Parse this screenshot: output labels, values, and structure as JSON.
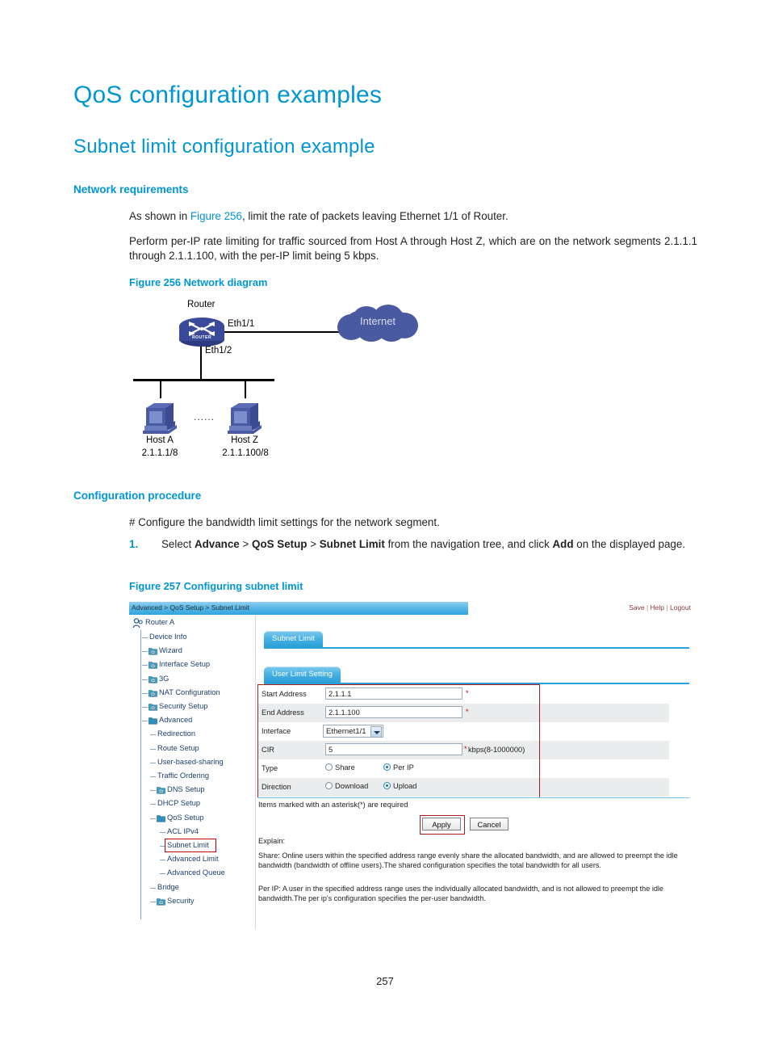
{
  "document": {
    "title": "QoS configuration examples",
    "subtitle": "Subnet limit configuration example",
    "section_network": "Network requirements",
    "section_procedure": "Configuration procedure",
    "para1_a": "As shown in ",
    "para1_link": "Figure 256",
    "para1_b": ", limit the rate of packets leaving Ethernet 1/1 of Router.",
    "para2": "Perform per-IP rate limiting for traffic sourced from Host A through Host Z, which are on the network segments 2.1.1.1 through 2.1.1.100, with the per-IP limit being 5 kbps.",
    "figcap256": "Figure 256 Network diagram",
    "para3": "# Configure the bandwidth limit settings for the network segment.",
    "step1_num": "1.",
    "step1_a": "Select ",
    "step1_b1": "Advance",
    "step1_c": " > ",
    "step1_b2": "QoS Setup",
    "step1_d": " > ",
    "step1_b3": "Subnet Limit",
    "step1_e": " from the navigation tree, and click ",
    "step1_b4": "Add",
    "step1_f": " on the displayed page.",
    "figcap257": "Figure 257 Configuring subnet limit",
    "page_number": "257",
    "accent_color": "#0096d6"
  },
  "diagram": {
    "router_label": "Router",
    "router_badge": "ROUTER",
    "eth1_1": "Eth1/1",
    "eth1_2": "Eth1/2",
    "internet": "Internet",
    "host_a": "Host A",
    "host_a_ip": "2.1.1.1/8",
    "host_z": "Host Z",
    "host_z_ip": "2.1.1.100/8",
    "ellipsis": "......",
    "node_color": "#4a5aa0"
  },
  "webui": {
    "breadcrumb": "Advanced > QoS Setup > Subnet Limit",
    "account": {
      "save": "Save",
      "help": "Help",
      "logout": "Logout",
      "sep": "|"
    },
    "tree": {
      "root": "Router A",
      "items": [
        {
          "label": "Device Info",
          "icon": "none",
          "indent": 1
        },
        {
          "label": "Wizard",
          "icon": "folder-plus-icon",
          "indent": 1
        },
        {
          "label": "Interface Setup",
          "icon": "folder-plus-icon",
          "indent": 1
        },
        {
          "label": "3G",
          "icon": "folder-plus-icon",
          "indent": 1
        },
        {
          "label": "NAT Configuration",
          "icon": "folder-plus-icon",
          "indent": 1
        },
        {
          "label": "Security Setup",
          "icon": "folder-plus-icon",
          "indent": 1
        },
        {
          "label": "Advanced",
          "icon": "folder-open-icon",
          "indent": 1
        },
        {
          "label": "Redirection",
          "icon": "none",
          "indent": 2
        },
        {
          "label": "Route Setup",
          "icon": "none",
          "indent": 2
        },
        {
          "label": "User-based-sharing",
          "icon": "none",
          "indent": 2
        },
        {
          "label": "Traffic Ordering",
          "icon": "none",
          "indent": 2
        },
        {
          "label": "DNS Setup",
          "icon": "folder-plus-icon",
          "indent": 2
        },
        {
          "label": "DHCP Setup",
          "icon": "none",
          "indent": 2
        },
        {
          "label": "QoS Setup",
          "icon": "folder-open-icon",
          "indent": 2
        },
        {
          "label": "ACL IPv4",
          "icon": "none",
          "indent": 3
        },
        {
          "label": "Subnet Limit",
          "icon": "none",
          "indent": 3,
          "selected": true
        },
        {
          "label": "Advanced Limit",
          "icon": "none",
          "indent": 3
        },
        {
          "label": "Advanced Queue",
          "icon": "none",
          "indent": 3
        },
        {
          "label": "Bridge",
          "icon": "none",
          "indent": 2
        },
        {
          "label": "Security",
          "icon": "folder-plus-icon",
          "indent": 2
        }
      ]
    },
    "tabs": {
      "primary": "Subnet Limit",
      "secondary": "User Limit Setting"
    },
    "form": {
      "rows": [
        {
          "label": "Start Address",
          "value": "2.1.1.1",
          "required": "*"
        },
        {
          "label": "End Address",
          "value": "2.1.1.100",
          "required": "*"
        },
        {
          "label": "Interface",
          "value": "Ethernet1/1"
        },
        {
          "label": "CIR",
          "value": "5",
          "required": "*",
          "unit": "kbps(8-1000000)"
        },
        {
          "label": "Type",
          "options": [
            "Share",
            "Per IP"
          ],
          "selected": "Per IP"
        },
        {
          "label": "Direction",
          "options": [
            "Download",
            "Upload"
          ],
          "selected": "Upload"
        }
      ],
      "required_note": "Items marked with an asterisk(*) are required",
      "apply": "Apply",
      "cancel": "Cancel"
    },
    "explain": {
      "heading": "Explain:",
      "share": "Share: Online users within the specified address range evenly share the allocated bandwidth, and are allowed to preempt the idle bandwidth (bandwidth of offline users).The shared configuration specifies the total bandwidth for all users.",
      "perip": "Per IP: A user in the specified address range uses the individually allocated bandwidth, and is not allowed to preempt the idle bandwidth.The per ip's configuration specifies the per-user bandwidth."
    }
  }
}
